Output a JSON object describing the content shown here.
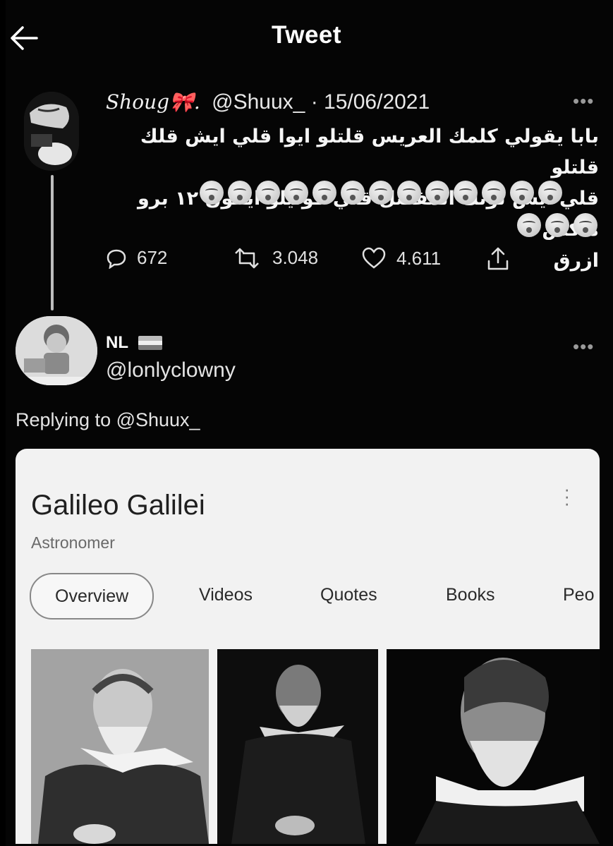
{
  "header": {
    "title": "Tweet"
  },
  "tweet": {
    "name": "Shoug🎀.",
    "handle": "@Shuux_",
    "separator": "·",
    "date": "15/06/2021",
    "lines": [
      "بابا يقولي كلمك العريس قلتلو ايوا قلي ايش قلك قلتلو",
      "قلي ايش لونك المفضل قلي قوليلو ايفون ١٢ برو ماكس",
      "ازرق"
    ],
    "emoji_row1_count": 13,
    "emoji_row2_count": 3,
    "stats": {
      "replies": "672",
      "retweets": "3.048",
      "likes": "4.611"
    }
  },
  "reply": {
    "name": "NL",
    "handle": "@lonlyclowny",
    "replying_to": "Replying to @Shuux_"
  },
  "card": {
    "title": "Galileo Galilei",
    "subtitle": "Astronomer",
    "tabs": [
      "Overview",
      "Videos",
      "Quotes",
      "Books",
      "Peo"
    ],
    "active_tab": "Overview"
  },
  "icons": [
    "back-arrow-icon",
    "more-dots-icon",
    "reply-icon",
    "retweet-icon",
    "like-icon",
    "share-icon",
    "flag-icon",
    "kebab-menu-icon"
  ]
}
